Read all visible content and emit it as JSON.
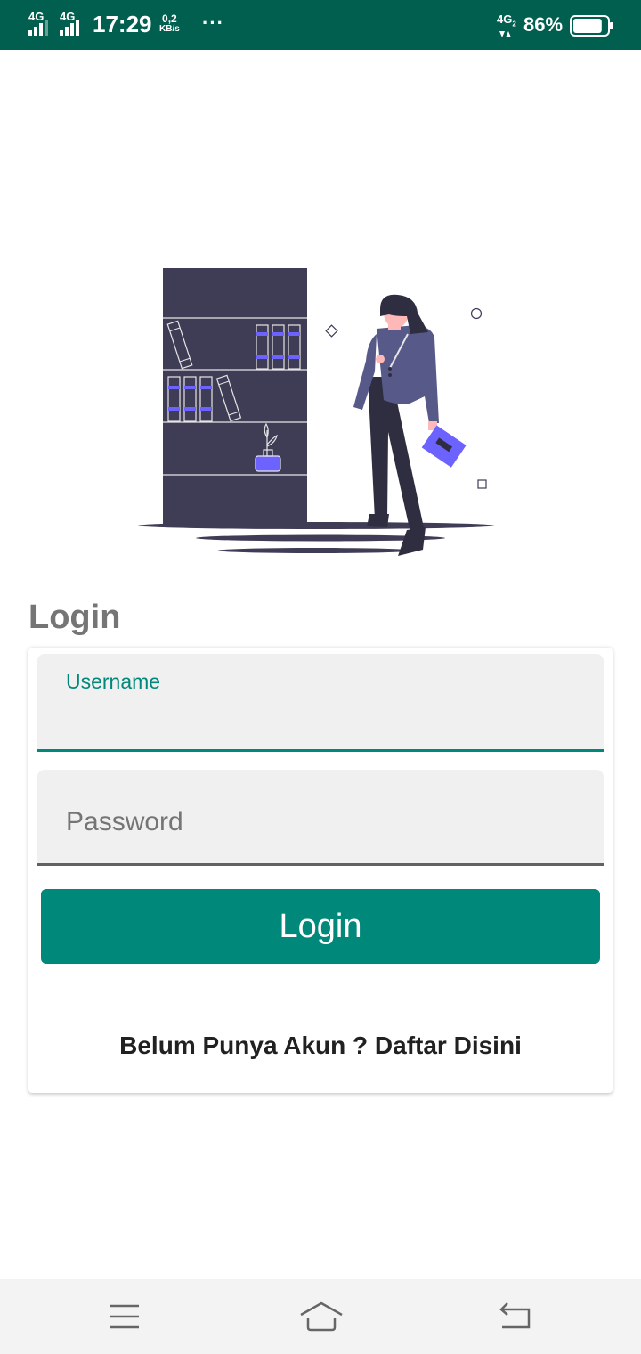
{
  "status_bar": {
    "network_1": "4G",
    "network_2": "4G",
    "time": "17:29",
    "speed_value": "0,2",
    "speed_unit": "KB/s",
    "more": "···",
    "network_3": "4G",
    "network_3_sub": "2",
    "battery_percent": "86%",
    "battery_level": 0.86
  },
  "illustration": {
    "icon": "reading-woman-bookshelf-illustration",
    "colors": {
      "shelf": "#3f3d56",
      "accent": "#6c63ff",
      "jacket": "#575a89",
      "pants": "#2f2e41",
      "hair": "#2f2e41",
      "skin": "#ffb8b8"
    }
  },
  "login": {
    "title": "Login",
    "username_label": "Username",
    "username_value": "",
    "password_placeholder": "Password",
    "password_value": "",
    "button_label": "Login",
    "register_link": "Belum Punya Akun ? Daftar Disini"
  },
  "nav_bar": {
    "menu_icon": "menu-icon",
    "home_icon": "home-icon",
    "back_icon": "back-icon"
  },
  "colors": {
    "status_bar": "#005f4e",
    "primary": "#00897b",
    "field_bg": "#f0f0f0",
    "title_text": "#757575"
  }
}
